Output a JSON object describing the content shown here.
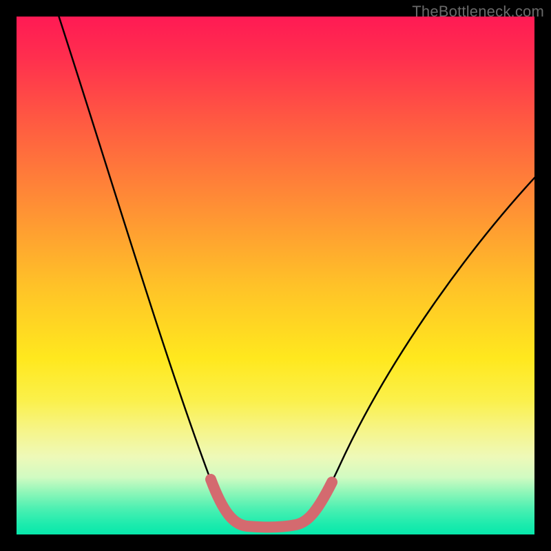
{
  "watermark": "TheBottleneck.com",
  "colors": {
    "frame": "#000000",
    "curve": "#000000",
    "highlight": "#d46a6f",
    "gradient_top": "#ff1a54",
    "gradient_bottom": "#07e8ab"
  },
  "chart_data": {
    "type": "line",
    "title": "",
    "xlabel": "",
    "ylabel": "",
    "xlim": [
      0,
      100
    ],
    "ylim": [
      0,
      100
    ],
    "x": [
      0,
      5,
      10,
      15,
      20,
      25,
      30,
      35,
      38,
      40,
      42,
      44,
      46,
      48,
      50,
      52,
      55,
      60,
      65,
      70,
      75,
      80,
      85,
      90,
      95,
      100
    ],
    "series": [
      {
        "name": "bottleneck-curve",
        "values": [
          100,
          88,
          76,
          64,
          52,
          40,
          28,
          16,
          7,
          3,
          1.5,
          1,
          1,
          1,
          1.5,
          3,
          8,
          17,
          26,
          34,
          42,
          50,
          57,
          63,
          68,
          72
        ]
      }
    ],
    "highlight_range_x": [
      38,
      52
    ],
    "annotations": []
  }
}
